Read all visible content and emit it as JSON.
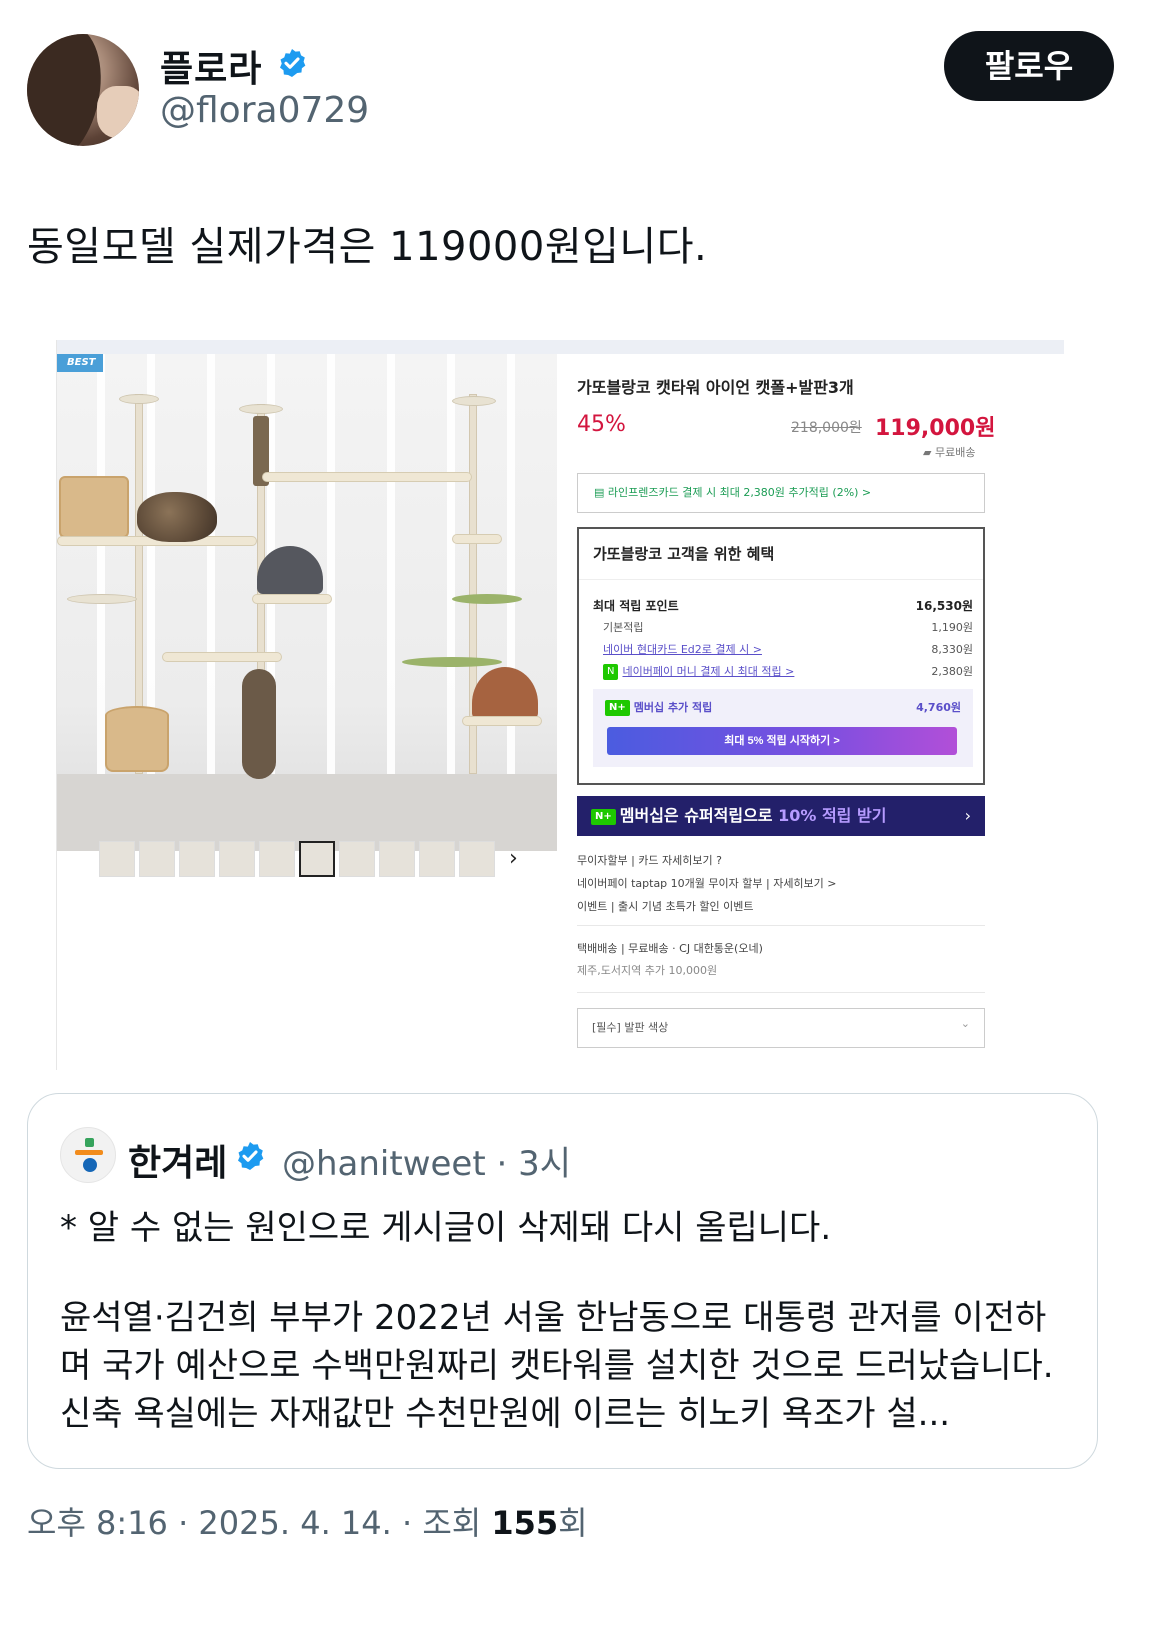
{
  "user": {
    "display_name": "플로라",
    "handle": "@flora0729",
    "follow_label": "팔로우"
  },
  "tweet": {
    "text": "동일모델 실제가격은 119000원입니다."
  },
  "product": {
    "best_badge": "BEST",
    "title": "가또블랑코 캣타워 아이언 캣폴+발판3개",
    "discount": "45%",
    "original_price": "218,000원",
    "price": "119,000원",
    "shipping": "무료배송",
    "card_promo": "라인프렌즈카드 결제 시 최대 2,380원 추가적립 (2%) >",
    "benefit_title": "가또블랑코 고객을 위한 혜택",
    "points": [
      {
        "label": "최대 적립 포인트",
        "value": "16,530원"
      },
      {
        "label": "기본적립",
        "value": "1,190원"
      },
      {
        "label": "네이버 현대카드 Ed2로 결제 시 >",
        "value": "8,330원"
      },
      {
        "label": "네이버페이 머니 결제 시 최대 적립 >",
        "value": "2,380원"
      }
    ],
    "membership_label": "멤버십 추가 적립",
    "membership_value": "4,760원",
    "membership_button": "최대 5% 적립 시작하기 >",
    "super_bar_prefix": "멤버십은 슈퍼적립으로 ",
    "super_bar_highlight": "10% 적립 받기",
    "info_lines": [
      "무이자할부 | 카드 자세히보기 ?",
      "네이버페이 taptap 10개월 무이자 할부 | 자세히보기 >",
      "이벤트 | 출시 기념 초특가 할인 이벤트"
    ],
    "delivery_line": "택배배송 | 무료배송 · CJ 대한통운(오네)",
    "delivery_extra": "제주,도서지역 추가 10,000원",
    "option_label": "[필수] 발판 색상"
  },
  "quote": {
    "display_name": "한겨레",
    "handle_time": "@hanitweet · 3시",
    "line1": "* 알 수 없는 원인으로 게시글이 삭제돼 다시 올립니다.",
    "body": "윤석열·김건희 부부가 2022년 서울 한남동으로 대통령 관저를 이전하며 국가 예산으로 수백만원짜리 캣타워를 설치한 것으로 드러났습니다. 신축 욕실에는 자재값만 수천만원에 이르는 히노키 욕조가 설..."
  },
  "footer": {
    "time": "오후 8:16 · 2025. 4. 14. · 조회 ",
    "views": "155",
    "suffix": "회"
  },
  "colors": {
    "verified": "#1d9bf0",
    "price_red": "#d3153e",
    "text": "#0f1419",
    "muted": "#536471"
  }
}
